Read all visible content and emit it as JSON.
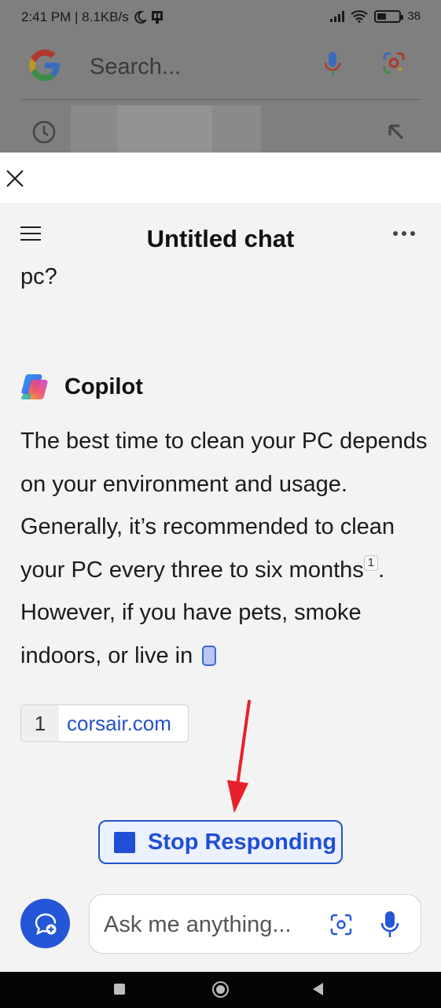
{
  "status_bar": {
    "time_speed": "2:41 PM | 8.1KB/s",
    "battery": "38"
  },
  "google_bar": {
    "search_placeholder": "Search..."
  },
  "chat": {
    "title": "Untitled chat",
    "user_message_tail": "pc?",
    "assistant_name": "Copilot",
    "answer_part1": "The best time to clean your PC depends on your environment and usage. Generally, it’s recommended to clean your PC every three to six months",
    "citation_marker": "1",
    "answer_part2": ". However, if you have pets, smoke indoors, or live in",
    "sources": [
      {
        "num": "1",
        "label": "corsair.com"
      }
    ],
    "stop_button_label": "Stop Responding"
  },
  "composer": {
    "placeholder": "Ask me anything..."
  },
  "colors": {
    "accent": "#2452c7",
    "annotation_arrow": "#e8202a"
  },
  "icons": [
    "close-icon",
    "menu-icon",
    "more-icon",
    "copilot-logo",
    "new-chat-icon",
    "visual-search-icon",
    "microphone-icon"
  ]
}
